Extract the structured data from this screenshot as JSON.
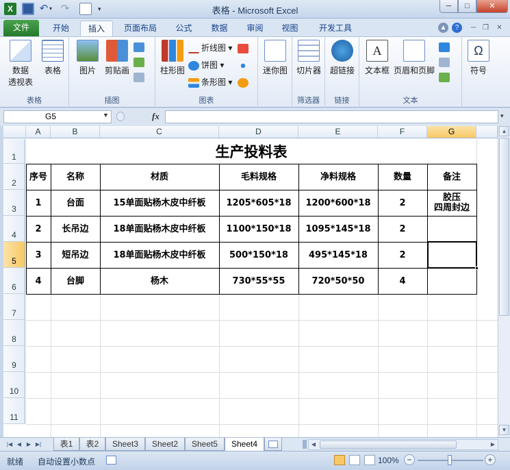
{
  "window": {
    "title": "表格 - Microsoft Excel",
    "minimize": "─",
    "maximize": "□",
    "close": "✕"
  },
  "ribbon_tabs": [
    "文件",
    "开始",
    "插入",
    "页面布局",
    "公式",
    "数据",
    "审阅",
    "视图",
    "开发工具"
  ],
  "ribbon_groups": {
    "tables": {
      "label": "表格",
      "pivot_label_1": "数据",
      "pivot_label_2": "透视表",
      "table_label": "表格"
    },
    "illustrations": {
      "label": "插图",
      "picture_label": "图片",
      "clipart_label": "剪贴画"
    },
    "charts": {
      "label": "图表",
      "column_label": "柱形图",
      "line_label": "折线图",
      "pie_label": "饼图",
      "bar_label": "条形图"
    },
    "sparklines": {
      "label": "迷你图"
    },
    "filter": {
      "label": "筛选器",
      "slicer_label": "切片器"
    },
    "links": {
      "label": "链接",
      "hyperlink_label": "超链接"
    },
    "text": {
      "label": "文本",
      "textbox_label": "文本框",
      "header_footer_label": "页眉和页脚"
    },
    "symbols": {
      "label": "符号"
    }
  },
  "formula_bar": {
    "name_box": "G5",
    "fx": "fx",
    "value": ""
  },
  "columns": [
    "A",
    "B",
    "C",
    "D",
    "E",
    "F",
    "G"
  ],
  "rows": [
    "1",
    "2",
    "3",
    "4",
    "5",
    "6",
    "7",
    "8",
    "9",
    "10",
    "11"
  ],
  "sheet": {
    "title": "生产投料表",
    "headers": [
      "序号",
      "名称",
      "材质",
      "毛料规格",
      "净料规格",
      "数量",
      "备注"
    ],
    "rows": [
      [
        "1",
        "台面",
        "15单面贴杨木皮中纤板",
        "1205*605*18",
        "1200*600*18",
        "2",
        "胶压\n四周封边"
      ],
      [
        "2",
        "长吊边",
        "18单面贴杨木皮中纤板",
        "1100*150*18",
        "1095*145*18",
        "2",
        ""
      ],
      [
        "3",
        "短吊边",
        "18单面贴杨木皮中纤板",
        "500*150*18",
        "495*145*18",
        "2",
        ""
      ],
      [
        "4",
        "台脚",
        "杨木",
        "730*55*55",
        "720*50*50",
        "4",
        ""
      ]
    ]
  },
  "sheet_tabs": [
    "表1",
    "表2",
    "Sheet3",
    "Sheet2",
    "Sheet5",
    "Sheet4"
  ],
  "active_sheet": "Sheet4",
  "status": {
    "ready": "就绪",
    "auto_decimal": "自动设置小数点",
    "zoom": "100%"
  },
  "colors": {
    "excel_green": "#1f7a2b",
    "selected_header": "#f8c864"
  }
}
